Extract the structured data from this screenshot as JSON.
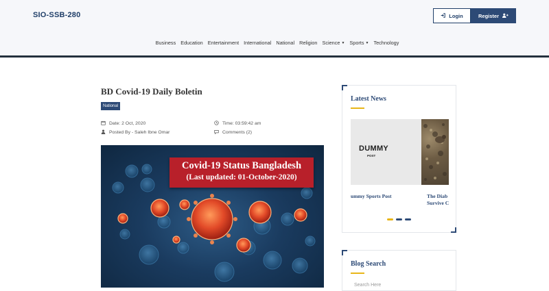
{
  "header": {
    "brand": "SIO-SSB-280",
    "login_label": "Login",
    "register_label": "Register"
  },
  "nav": {
    "items": [
      "Business",
      "Education",
      "Entertainment",
      "International",
      "National",
      "Religion",
      "Science",
      "Sports",
      "Technology"
    ]
  },
  "post": {
    "title": "BD Covid-19 Daily Boletin",
    "category": "National",
    "date": "Date: 2 Oct, 2020",
    "time": "Time: 03:59:42 am",
    "author": "Posted By - Saleh Ibne Omar",
    "comments": "Comments (2)",
    "image_heading": "Covid-19 Status Bangladesh",
    "image_subheading": "(Last updated: 01-October-2020)"
  },
  "latest_news": {
    "title": "Latest News",
    "dummy_word": "DUMMY",
    "dummy_sub": "POST",
    "slide1_caption": "ummy Sports Post",
    "slide2_caption_l1": "The Diab",
    "slide2_caption_l2": "Survive C"
  },
  "blog_search": {
    "title": "Blog Search",
    "placeholder": "Search Here"
  },
  "colors": {
    "primary": "#2d4a76",
    "accent": "#e8b517",
    "banner_red": "#b8202a"
  }
}
